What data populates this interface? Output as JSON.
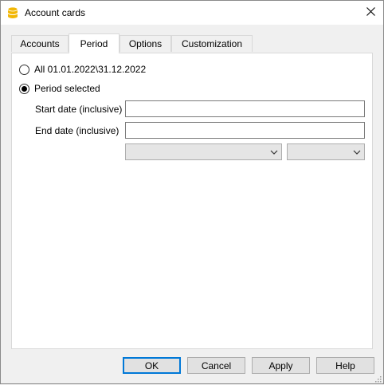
{
  "window": {
    "title": "Account cards",
    "app_icon": "database-icon",
    "close_icon": "close-icon"
  },
  "tabs": [
    {
      "label": "Accounts",
      "active": false
    },
    {
      "label": "Period",
      "active": true
    },
    {
      "label": "Options",
      "active": false
    },
    {
      "label": "Customization",
      "active": false
    }
  ],
  "period": {
    "all_option": {
      "label": "All 01.01.2022\\31.12.2022",
      "selected": false
    },
    "selected_option": {
      "label": "Period selected",
      "selected": true
    },
    "start_date": {
      "label": "Start date (inclusive)",
      "value": ""
    },
    "end_date": {
      "label": "End date (inclusive)",
      "value": ""
    },
    "combo1": {
      "value": ""
    },
    "combo2": {
      "value": ""
    }
  },
  "buttons": {
    "ok": "OK",
    "cancel": "Cancel",
    "apply": "Apply",
    "help": "Help"
  },
  "colors": {
    "accent": "#0078d7",
    "icon_yellow": "#f2b705"
  }
}
